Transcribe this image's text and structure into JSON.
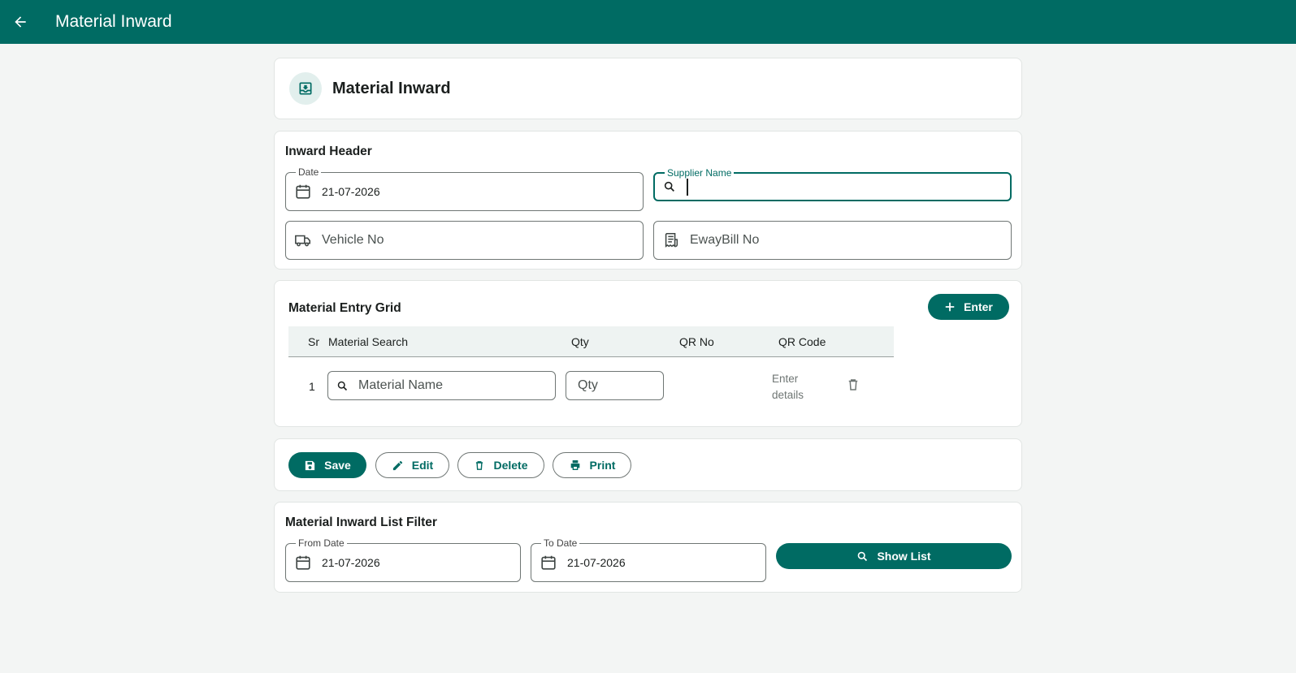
{
  "appbar": {
    "title": "Material Inward",
    "back_icon": "arrow-left-icon"
  },
  "page_header": {
    "title": "Material Inward",
    "icon": "inbox-download-icon"
  },
  "inward_header": {
    "title": "Inward Header",
    "date": {
      "label": "Date",
      "value": "21-07-2026"
    },
    "supplier": {
      "label": "Supplier Name",
      "value": ""
    },
    "vehicle": {
      "placeholder": "Vehicle No"
    },
    "eway": {
      "placeholder": "EwayBill No"
    }
  },
  "grid": {
    "title": "Material Entry Grid",
    "enter_button": "Enter",
    "columns": [
      "Sr",
      "Material Search",
      "Qty",
      "QR No",
      "QR Code"
    ],
    "rows": [
      {
        "sr": "1",
        "material_placeholder": "Material Name",
        "qty_placeholder": "Qty",
        "qr_no": "",
        "qr_code_line1": "Enter",
        "qr_code_line2": "details"
      }
    ]
  },
  "actions": {
    "save": "Save",
    "edit": "Edit",
    "delete": "Delete",
    "print": "Print"
  },
  "filter": {
    "title": "Material Inward List Filter",
    "from": {
      "label": "From Date",
      "value": "21-07-2026"
    },
    "to": {
      "label": "To Date",
      "value": "21-07-2026"
    },
    "show_list": "Show List"
  },
  "colors": {
    "primary": "#006b63",
    "background": "#f3f5f4",
    "icon_bg": "#e2efed"
  }
}
